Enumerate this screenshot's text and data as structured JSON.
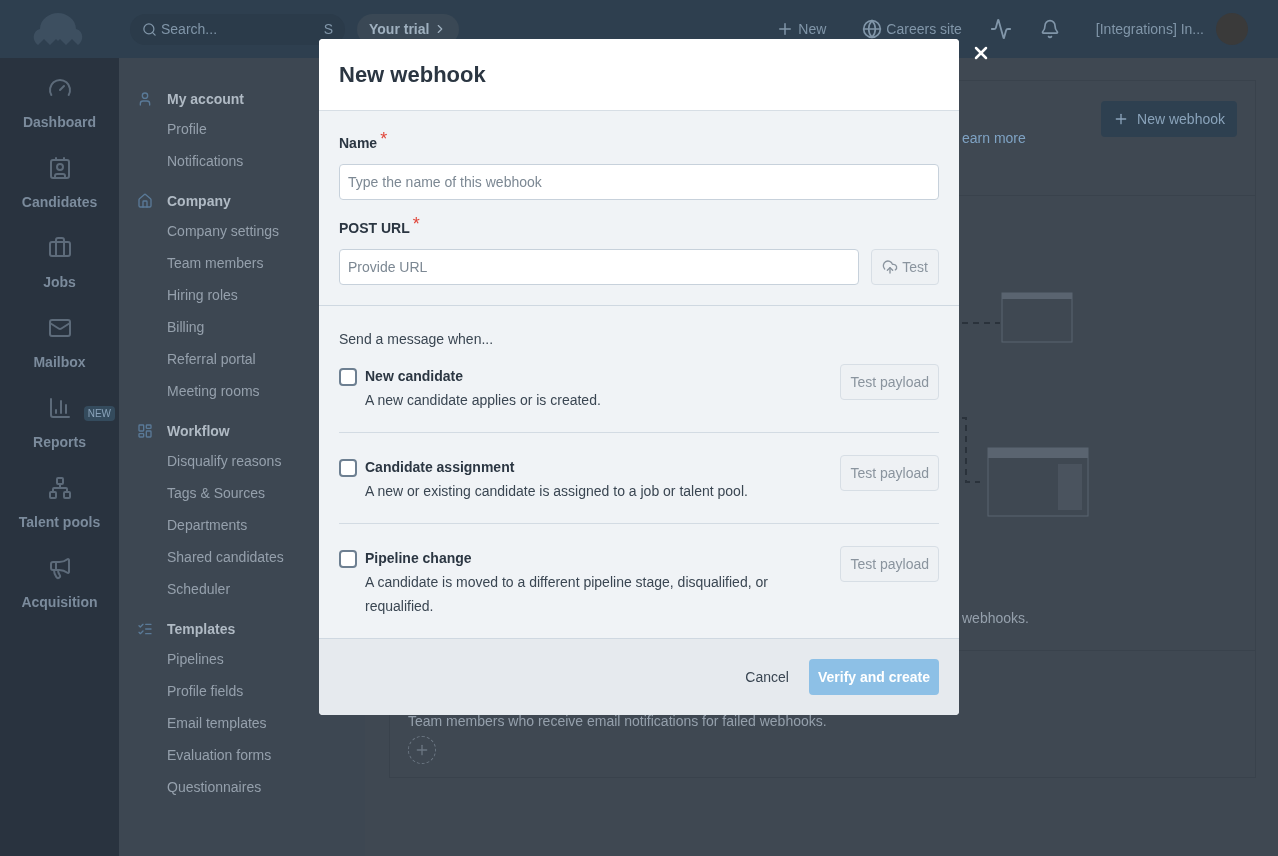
{
  "topbar": {
    "search_placeholder": "Search...",
    "search_shortcut": "S",
    "trial": "Your trial",
    "new": "New",
    "careers": "Careers site",
    "account": "[Integrations] In..."
  },
  "rail": [
    {
      "label": "Dashboard"
    },
    {
      "label": "Candidates"
    },
    {
      "label": "Jobs"
    },
    {
      "label": "Mailbox"
    },
    {
      "label": "Reports",
      "badge": "NEW"
    },
    {
      "label": "Talent pools"
    },
    {
      "label": "Acquisition"
    }
  ],
  "settings_nav": [
    {
      "title": "My account",
      "items": [
        "Profile",
        "Notifications"
      ]
    },
    {
      "title": "Company",
      "items": [
        "Company settings",
        "Team members",
        "Hiring roles",
        "Billing",
        "Referral portal",
        "Meeting rooms"
      ]
    },
    {
      "title": "Workflow",
      "items": [
        "Disqualify reasons",
        "Tags & Sources",
        "Departments",
        "Shared candidates",
        "Scheduler"
      ]
    },
    {
      "title": "Templates",
      "items": [
        "Pipelines",
        "Profile fields",
        "Email templates",
        "Evaluation forms",
        "Questionnaires"
      ]
    }
  ],
  "page": {
    "new_webhook_button": "New webhook",
    "learn_more": "earn more",
    "empty_note": "webhooks.",
    "notify_text": "Team members who receive email notifications for failed webhooks."
  },
  "modal": {
    "title": "New webhook",
    "fields": [
      {
        "label": "Name",
        "required_mark": "*",
        "placeholder": "Type the name of this webhook"
      },
      {
        "label": "POST URL",
        "required_mark": "*",
        "placeholder": "Provide URL",
        "button": "Test"
      }
    ],
    "events_heading": "Send a message when...",
    "events": [
      {
        "title": "New candidate",
        "description": "A new candidate applies or is created.",
        "checked": false,
        "button": "Test payload"
      },
      {
        "title": "Candidate assignment",
        "description": "A new or existing candidate is assigned to a job or talent pool.",
        "checked": false,
        "button": "Test payload"
      },
      {
        "title": "Pipeline change",
        "description": "A candidate is moved to a different pipeline stage, disqualified, or requalified.",
        "checked": false,
        "button": "Test payload"
      }
    ],
    "cancel": "Cancel",
    "submit": {
      "label": "Verify and create",
      "disabled": true
    }
  }
}
